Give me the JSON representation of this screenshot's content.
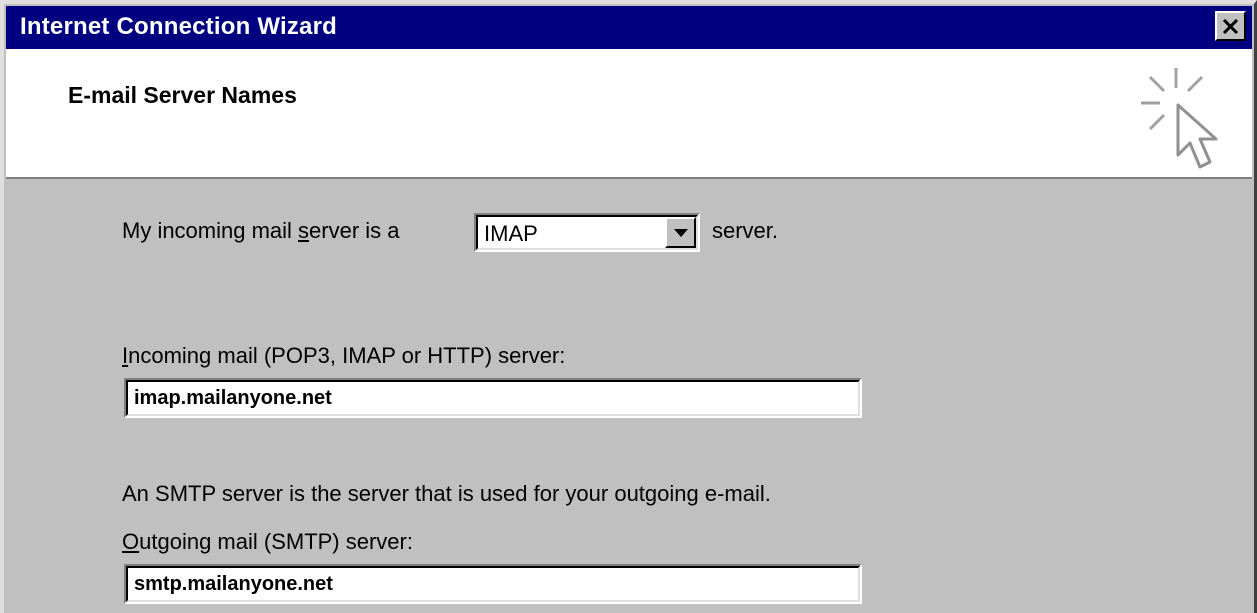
{
  "window": {
    "title": "Internet Connection Wizard"
  },
  "header": {
    "title": "E-mail Server Names",
    "icon": "wizard-cursor-icon"
  },
  "server_type": {
    "label_before_mnemonic": "My incoming mail ",
    "label_mnemonic": "s",
    "label_after_mnemonic": "erver is a",
    "selected": "IMAP",
    "suffix": "server."
  },
  "incoming": {
    "label_mnemonic": "I",
    "label_rest": "ncoming mail (POP3, IMAP or HTTP) server:",
    "value": "imap.mailanyone.net"
  },
  "smtp_note": "An SMTP server is the server that is used for your outgoing e-mail.",
  "outgoing": {
    "label_mnemonic": "O",
    "label_rest": "utgoing mail (SMTP) server:",
    "value": "smtp.mailanyone.net"
  },
  "colors": {
    "titlebar": "#000080",
    "dialog_face": "#c0c0c0",
    "header_bg": "#ffffff"
  }
}
